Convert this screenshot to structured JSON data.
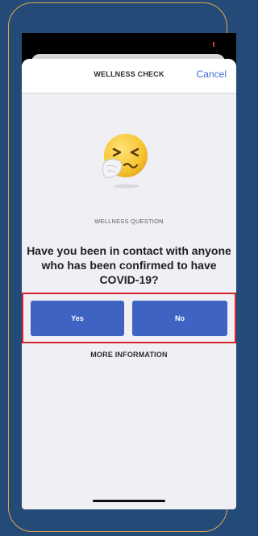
{
  "header": {
    "title": "WELLNESS CHECK",
    "cancel_label": "Cancel"
  },
  "content": {
    "emoji_icon": "sneezing-face-icon",
    "question_label": "WELLNESS QUESTION",
    "question_text": "Have you been in contact with anyone who has been confirmed to have COVID-19?"
  },
  "actions": {
    "yes_label": "Yes",
    "no_label": "No",
    "more_info_label": "MORE INFORMATION"
  },
  "colors": {
    "page_background": "#244a78",
    "frame_border": "#e0a84a",
    "button": "#3f63c3",
    "link": "#3f6fd8",
    "highlight": "#d8222e"
  }
}
